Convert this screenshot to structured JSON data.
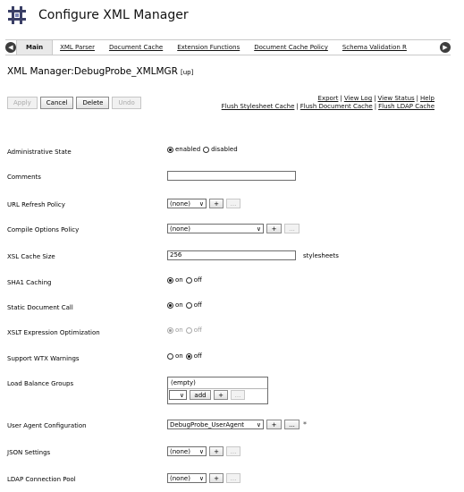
{
  "page": {
    "title": "Configure XML Manager",
    "title_icon": "grid-hash-icon"
  },
  "tabs": {
    "prev_arrow": "◀",
    "next_arrow": "▶",
    "items": [
      {
        "label": "Main",
        "active": true
      },
      {
        "label": "XML Parser"
      },
      {
        "label": "Document Cache"
      },
      {
        "label": "Extension Functions"
      },
      {
        "label": "Document Cache Policy"
      },
      {
        "label": "Schema Validation R"
      }
    ]
  },
  "object": {
    "heading": "XML Manager:DebugProbe_XMLMGR",
    "status": "[up]"
  },
  "actions": {
    "apply": "Apply",
    "cancel": "Cancel",
    "delete": "Delete",
    "undo": "Undo"
  },
  "links": {
    "export": "Export",
    "view_log": "View Log",
    "view_status": "View Status",
    "help": "Help",
    "flush_stylesheet": "Flush Stylesheet Cache",
    "flush_document": "Flush Document Cache",
    "flush_ldap": "Flush LDAP Cache",
    "separator": "|"
  },
  "fields": {
    "admin_state": {
      "label": "Administrative State",
      "opt1": "enabled",
      "opt2": "disabled"
    },
    "comments": {
      "label": "Comments",
      "value": ""
    },
    "url_refresh": {
      "label": "URL Refresh Policy",
      "value": "(none)",
      "add": "+",
      "more": "..."
    },
    "compile_options": {
      "label": "Compile Options Policy",
      "value": "(none)",
      "add": "+",
      "more": "..."
    },
    "xsl_cache": {
      "label": "XSL Cache Size",
      "value": "256",
      "unit": "stylesheets"
    },
    "sha1": {
      "label": "SHA1 Caching",
      "on": "on",
      "off": "off"
    },
    "static_doc": {
      "label": "Static Document Call",
      "on": "on",
      "off": "off"
    },
    "xslt_expr": {
      "label": "XSLT Expression Optimization",
      "on": "on",
      "off": "off"
    },
    "wtx": {
      "label": "Support WTX Warnings",
      "on": "on",
      "off": "off"
    },
    "load_balance": {
      "label": "Load Balance Groups",
      "empty": "(empty)",
      "add_btn": "add",
      "plus": "+",
      "more": "..."
    },
    "user_agent": {
      "label": "User Agent Configuration",
      "value": "DebugProbe_UserAgent",
      "add": "+",
      "more": "...",
      "required": "*"
    },
    "json": {
      "label": "JSON Settings",
      "value": "(none)",
      "add": "+",
      "more": "..."
    },
    "ldap": {
      "label": "LDAP Connection Pool",
      "value": "(none)",
      "add": "+",
      "more": "..."
    }
  }
}
